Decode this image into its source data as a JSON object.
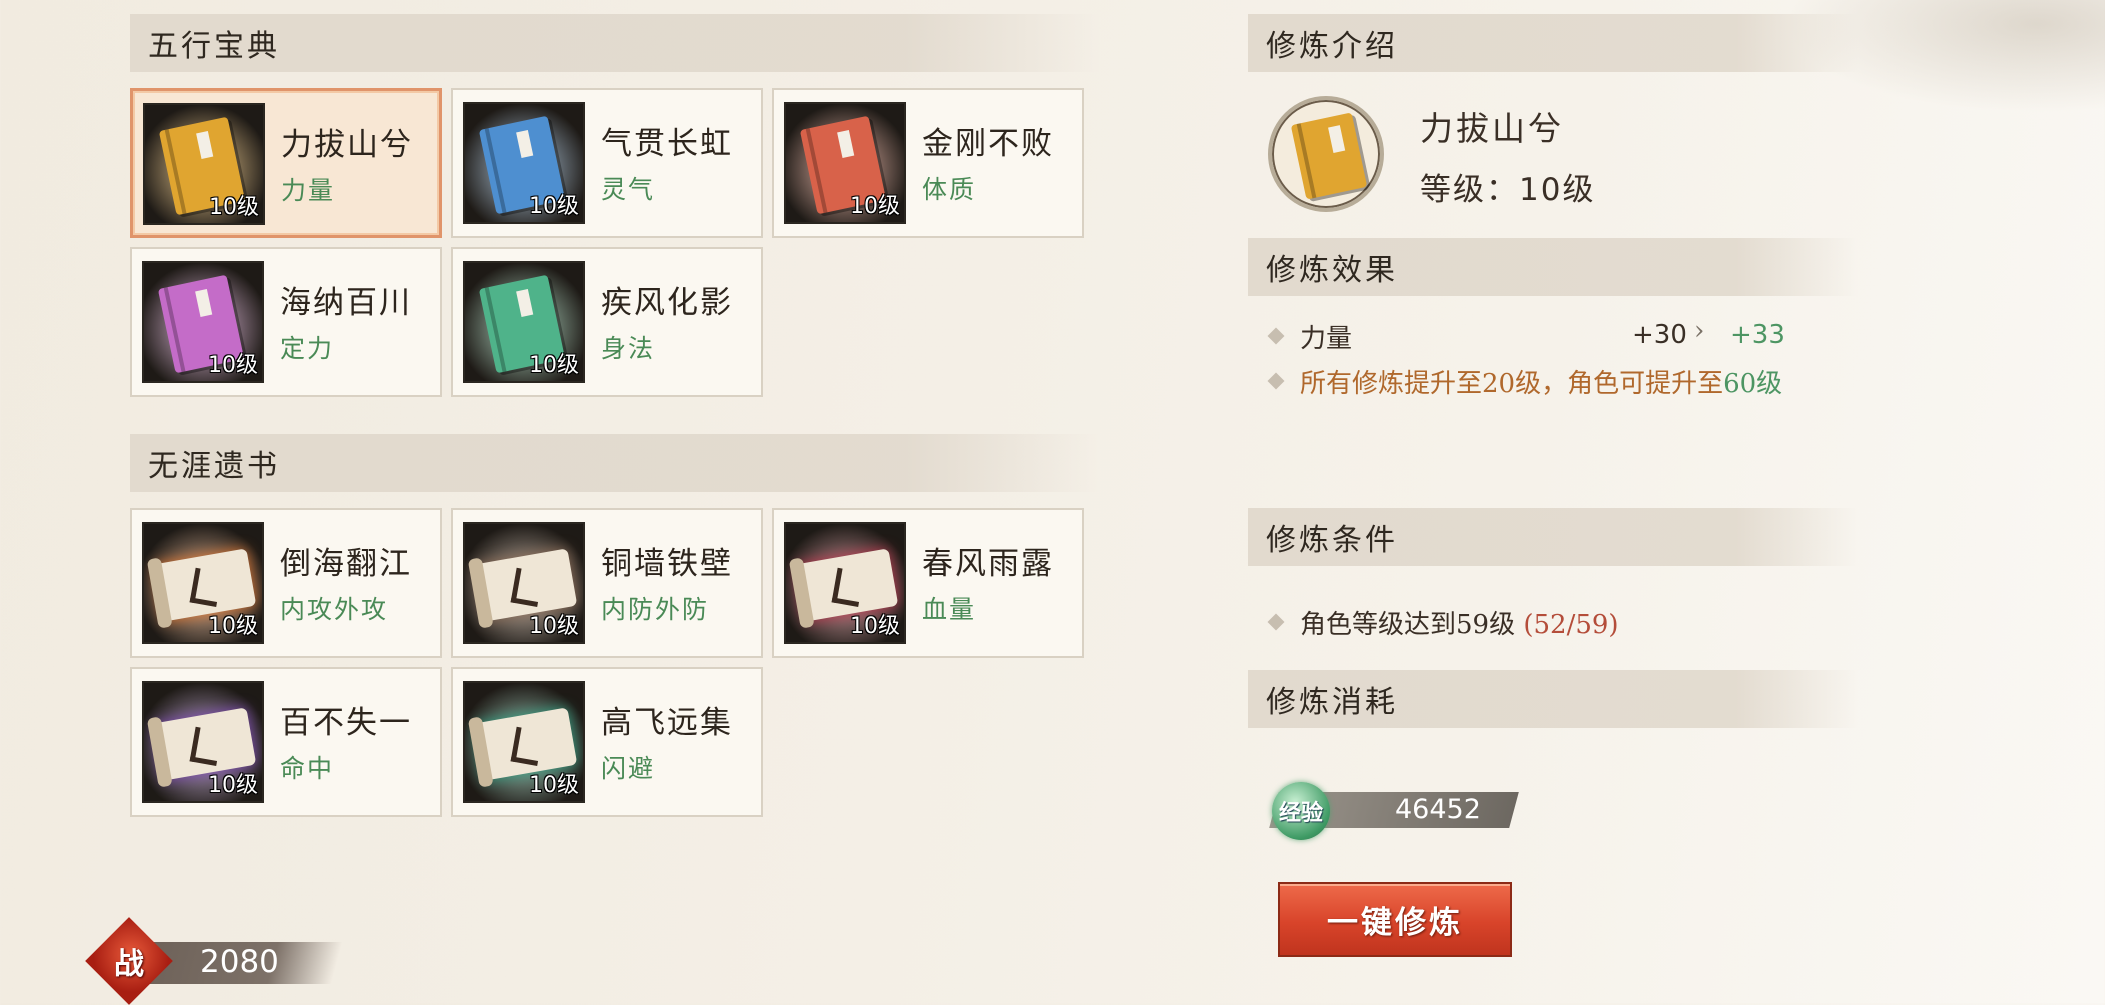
{
  "sections": {
    "wuxing": "五行宝典",
    "wuya": "无涯遗书",
    "intro": "修炼介绍",
    "effect": "修炼效果",
    "condition": "修炼条件",
    "cost": "修炼消耗"
  },
  "wuxing_cards": [
    {
      "name": "力拔山兮",
      "attr": "力量",
      "level": "10级",
      "icon": "golden-book-icon",
      "color": "#e0a530"
    },
    {
      "name": "气贯长虹",
      "attr": "灵气",
      "level": "10级",
      "icon": "blue-book-icon",
      "color": "#4e8fd0"
    },
    {
      "name": "金刚不败",
      "attr": "体质",
      "level": "10级",
      "icon": "red-book-icon",
      "color": "#d8624a"
    },
    {
      "name": "海纳百川",
      "attr": "定力",
      "level": "10级",
      "icon": "purple-book-icon",
      "color": "#c46cc8"
    },
    {
      "name": "疾风化影",
      "attr": "身法",
      "level": "10级",
      "icon": "green-book-icon",
      "color": "#4fb38a"
    }
  ],
  "wuya_cards": [
    {
      "name": "倒海翻江",
      "attr": "内攻外攻",
      "level": "10级",
      "icon": "orange-scroll-icon",
      "color": "#d9722e"
    },
    {
      "name": "铜墙铁壁",
      "attr": "内防外防",
      "level": "10级",
      "icon": "bronze-scroll-icon",
      "color": "#8a6a54"
    },
    {
      "name": "春风雨露",
      "attr": "血量",
      "level": "10级",
      "icon": "crimson-scroll-icon",
      "color": "#b8344a"
    },
    {
      "name": "百不失一",
      "attr": "命中",
      "level": "10级",
      "icon": "violet-scroll-icon",
      "color": "#7a46b0"
    },
    {
      "name": "高飞远集",
      "attr": "闪避",
      "level": "10级",
      "icon": "teal-scroll-icon",
      "color": "#2f9a7c"
    }
  ],
  "detail": {
    "name": "力拔山兮",
    "level_label": "等级：",
    "level_value": "10级"
  },
  "effect": {
    "stat": "力量",
    "current": "+30",
    "next": "+33",
    "note_prefix": "所有修炼提升至20级，角色可提升至",
    "note_highlight": "60级"
  },
  "condition": {
    "text": "角色等级达到59级",
    "progress": "(52/59)"
  },
  "cost": {
    "exp_label": "经验",
    "exp_value": "46452"
  },
  "train_button": "一键修炼",
  "power": {
    "char": "战",
    "value": "2080"
  }
}
